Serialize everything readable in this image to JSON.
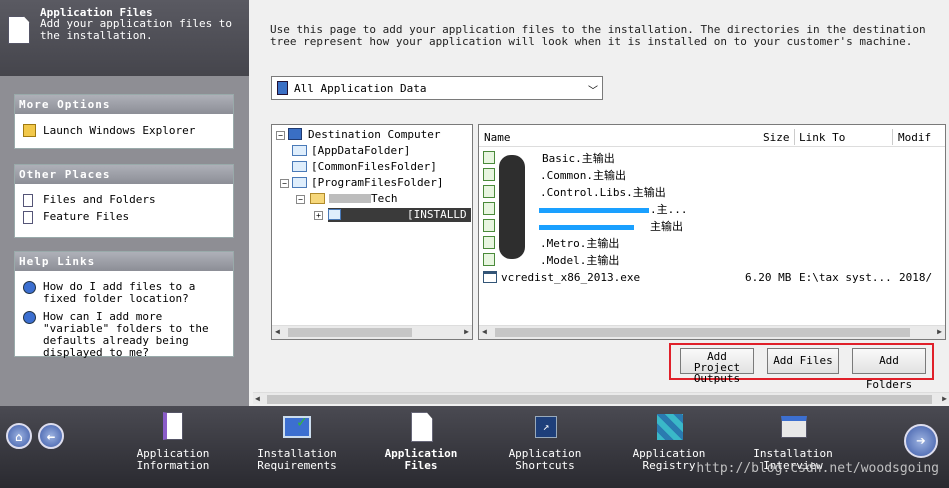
{
  "header": {
    "title": "Application Files",
    "subtitle": "Add your application files to the installation."
  },
  "sidebar": {
    "more_options": {
      "title": "More Options",
      "items": [
        {
          "label": "Launch Windows Explorer",
          "icon": "explorer-icon"
        }
      ]
    },
    "other_places": {
      "title": "Other Places",
      "items": [
        {
          "label": "Files and Folders",
          "icon": "document-icon"
        },
        {
          "label": "Feature Files",
          "icon": "document-icon"
        }
      ]
    },
    "help_links": {
      "title": "Help Links",
      "items": [
        {
          "label": "How do I add files to a fixed folder location?",
          "icon": "help-icon"
        },
        {
          "label": "How can I add more \"variable\" folders to the defaults already being displayed to me?",
          "icon": "help-icon"
        }
      ]
    }
  },
  "main": {
    "description": "Use this page to add your application files to the installation. The directories in the destination tree represent how your application will look when it is installed on to your customer's machine.",
    "filter": {
      "selected": "All Application Data"
    },
    "tree": {
      "root": "Destination Computer",
      "nodes": [
        "[AppDataFolder]",
        "[CommonFilesFolder]",
        "[ProgramFilesFolder]",
        "Tech",
        "[INSTALLD"
      ]
    },
    "files": {
      "columns": [
        "Name",
        "Size",
        "Link To",
        "Modif"
      ],
      "rows": [
        {
          "name": "Basic.主输出",
          "size": "",
          "link": "",
          "mod": ""
        },
        {
          "name": ".Common.主输出",
          "size": "",
          "link": "",
          "mod": ""
        },
        {
          "name": ".Control.Libs.主输出",
          "size": "",
          "link": "",
          "mod": ""
        },
        {
          "name": ".主...",
          "size": "",
          "link": "",
          "mod": ""
        },
        {
          "name": "主输出",
          "size": "",
          "link": "",
          "mod": ""
        },
        {
          "name": ".Metro.主输出",
          "size": "",
          "link": "",
          "mod": ""
        },
        {
          "name": ".Model.主输出",
          "size": "",
          "link": "",
          "mod": ""
        },
        {
          "name": "vcredist_x86_2013.exe",
          "size": "6.20 MB",
          "link": "E:\\tax syst...",
          "mod": "2018/"
        }
      ]
    },
    "buttons": {
      "add_project_outputs": "Add Project Outputs",
      "add_files": "Add Files",
      "add_folders": "Add Folders"
    }
  },
  "wizard": {
    "steps": [
      {
        "label": "Application Information",
        "icon": "app-info-icon"
      },
      {
        "label": "Installation Requirements",
        "icon": "requirements-icon"
      },
      {
        "label": "Application Files",
        "icon": "app-files-icon",
        "active": true
      },
      {
        "label": "Application Shortcuts",
        "icon": "shortcuts-icon"
      },
      {
        "label": "Application Registry",
        "icon": "registry-icon"
      },
      {
        "label": "Installation Interview",
        "icon": "interview-icon"
      }
    ],
    "watermark": "http://blog.csdn.net/woodsgoing"
  },
  "colors": {
    "highlight_box": "#e0202a",
    "panel_bg": "#8e8e94",
    "bar_bg": "#2a2a30"
  }
}
